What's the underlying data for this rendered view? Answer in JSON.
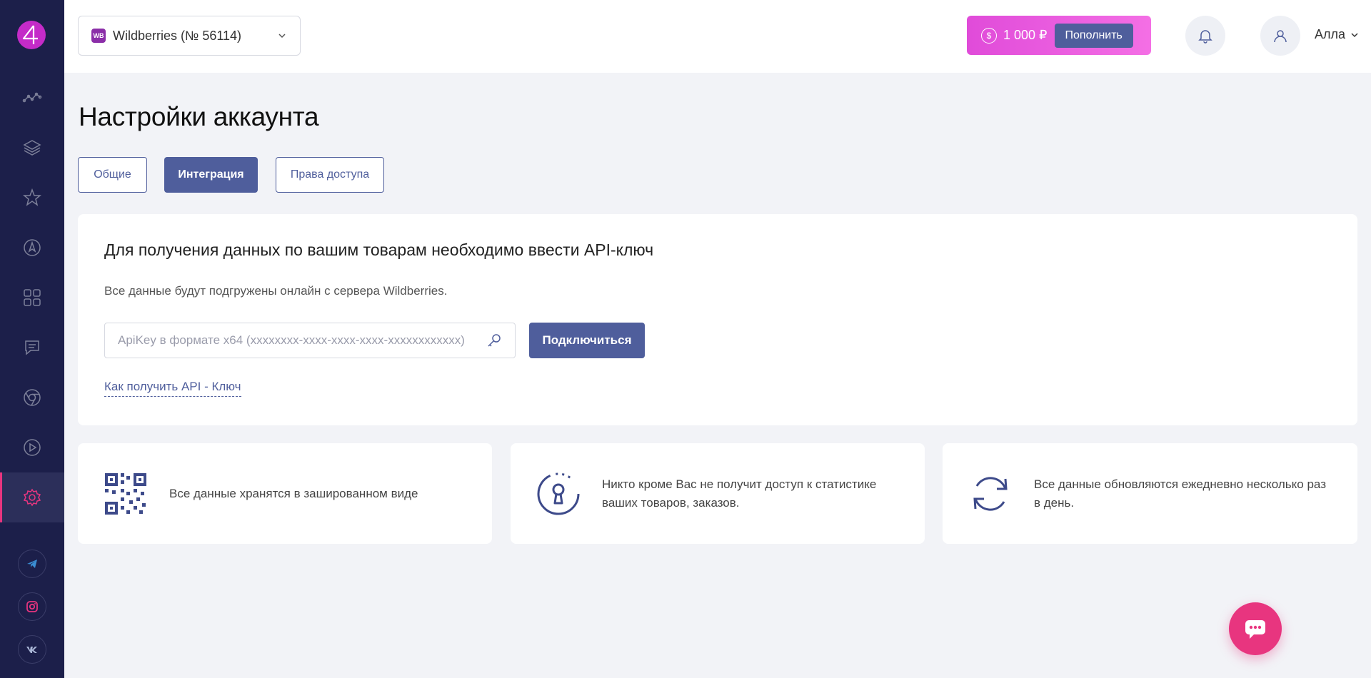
{
  "sidebar": {
    "logo_text": "4",
    "items": [
      {
        "icon": "analytics-icon"
      },
      {
        "icon": "layers-icon"
      },
      {
        "icon": "star-icon"
      },
      {
        "icon": "compass-icon"
      },
      {
        "icon": "grid-icon"
      },
      {
        "icon": "chat-icon"
      },
      {
        "icon": "chrome-icon"
      },
      {
        "icon": "play-icon"
      },
      {
        "icon": "settings-icon",
        "active": true
      }
    ],
    "social": [
      "telegram-icon",
      "instagram-icon",
      "vk-icon"
    ]
  },
  "header": {
    "store_badge": "WB",
    "store_name": "Wildberries (№ 56114)",
    "balance_symbol": "$",
    "balance": "1 000 ₽",
    "topup_label": "Пополнить",
    "user_name": "Алла"
  },
  "main": {
    "title": "Настройки аккаунта",
    "tabs": [
      {
        "label": "Общие"
      },
      {
        "label": "Интеграция",
        "active": true
      },
      {
        "label": "Права доступа"
      }
    ],
    "integration": {
      "heading": "Для получения данных по вашим товарам необходимо ввести API-ключ",
      "subtitle": "Все данные будут подгружены онлайн с сервера Wildberries.",
      "api_placeholder": "ApiKey в формате x64 (xxxxxxxx-xxxx-xxxx-xxxx-xxxxxxxxxxxx)",
      "api_value": "",
      "connect_label": "Подключиться",
      "help_link": "Как получить API - Ключ"
    },
    "features": [
      {
        "icon": "qr-code-icon",
        "text": "Все данные хранятся в зашированном виде"
      },
      {
        "icon": "keyhole-icon",
        "text": "Никто кроме Вас не получит доступ к статистике ваших товаров, заказов."
      },
      {
        "icon": "refresh-icon",
        "text": "Все данные обновляются ежедневно несколько раз в день."
      }
    ]
  },
  "colors": {
    "accent": "#4f5e9c",
    "sidebar": "#1c1f4a",
    "active": "#e8357f",
    "balance_gradient": "#e04bd9"
  }
}
